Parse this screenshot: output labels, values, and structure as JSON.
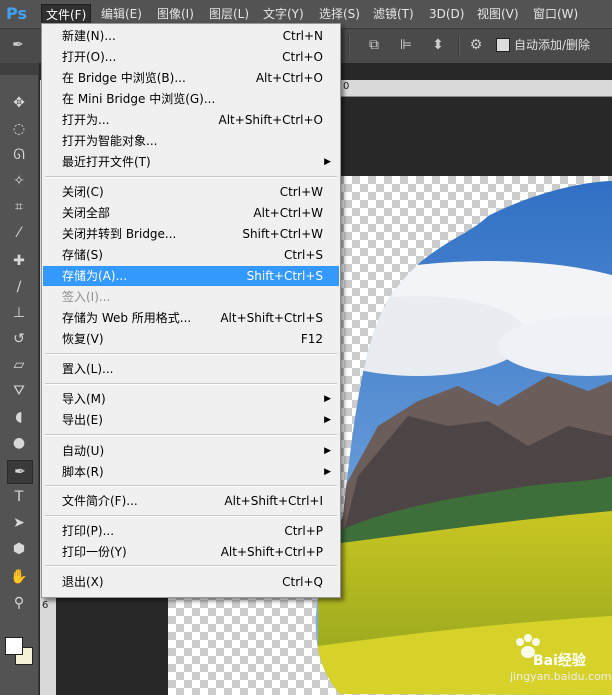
{
  "app": {
    "logo": "Ps"
  },
  "menubar": {
    "items": [
      "文件(F)",
      "编辑(E)",
      "图像(I)",
      "图层(L)",
      "文字(Y)",
      "选择(S)",
      "滤镜(T)",
      "3D(D)",
      "视图(V)",
      "窗口(W)"
    ],
    "active_index": 0
  },
  "optionsbar": {
    "auto_add_delete_label": "自动添加/删除",
    "auto_add_delete_checked": false
  },
  "file_menu": {
    "items": [
      {
        "label": "新建(N)...",
        "shortcut": "Ctrl+N"
      },
      {
        "label": "打开(O)...",
        "shortcut": "Ctrl+O"
      },
      {
        "label": "在 Bridge 中浏览(B)...",
        "shortcut": "Alt+Ctrl+O"
      },
      {
        "label": "在 Mini Bridge 中浏览(G)...",
        "shortcut": ""
      },
      {
        "label": "打开为...",
        "shortcut": "Alt+Shift+Ctrl+O"
      },
      {
        "label": "打开为智能对象...",
        "shortcut": ""
      },
      {
        "label": "最近打开文件(T)",
        "shortcut": "",
        "submenu": true
      },
      {
        "label": "关闭(C)",
        "shortcut": "Ctrl+W"
      },
      {
        "label": "关闭全部",
        "shortcut": "Alt+Ctrl+W"
      },
      {
        "label": "关闭并转到 Bridge...",
        "shortcut": "Shift+Ctrl+W"
      },
      {
        "label": "存储(S)",
        "shortcut": "Ctrl+S"
      },
      {
        "label": "存储为(A)...",
        "shortcut": "Shift+Ctrl+S",
        "highlighted": true
      },
      {
        "label": "签入(I)...",
        "shortcut": "",
        "disabled": true
      },
      {
        "label": "存储为 Web 所用格式...",
        "shortcut": "Alt+Shift+Ctrl+S"
      },
      {
        "label": "恢复(V)",
        "shortcut": "F12"
      },
      {
        "label": "置入(L)...",
        "shortcut": ""
      },
      {
        "label": "导入(M)",
        "shortcut": "",
        "submenu": true
      },
      {
        "label": "导出(E)",
        "shortcut": "",
        "submenu": true
      },
      {
        "label": "自动(U)",
        "shortcut": "",
        "submenu": true
      },
      {
        "label": "脚本(R)",
        "shortcut": "",
        "submenu": true
      },
      {
        "label": "文件简介(F)...",
        "shortcut": "Alt+Shift+Ctrl+I"
      },
      {
        "label": "打印(P)...",
        "shortcut": "Ctrl+P"
      },
      {
        "label": "打印一份(Y)",
        "shortcut": "Alt+Shift+Ctrl+P"
      },
      {
        "label": "退出(X)",
        "shortcut": "Ctrl+Q"
      }
    ]
  },
  "rulers": {
    "horizontal_tick": "0",
    "vertical_tick": "6"
  },
  "watermark": {
    "brand": "Bai",
    "brand2": "经验",
    "url": "jingyan.baidu.com"
  },
  "colors": {
    "highlight": "#3399ff",
    "menu_bg": "#f0f0f0",
    "ui_bg": "#535353",
    "logo": "#41a1f5"
  }
}
